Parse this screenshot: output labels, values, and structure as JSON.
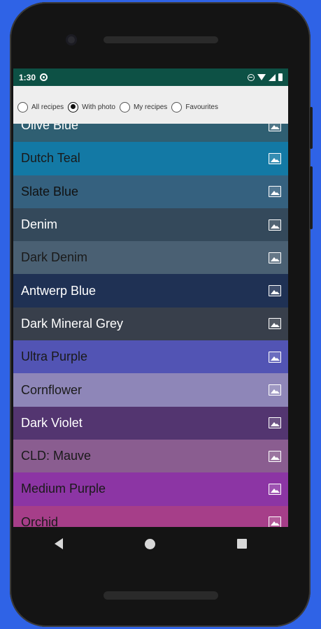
{
  "status_bar": {
    "time": "1:30"
  },
  "filters": [
    {
      "label": "All recipes",
      "checked": false
    },
    {
      "label": "With photo",
      "checked": true
    },
    {
      "label": "My recipes",
      "checked": false
    },
    {
      "label": "Favourites",
      "checked": false
    }
  ],
  "colors": [
    {
      "name": "Olive Blue",
      "bg": "#2f5f72",
      "fg": "#ffffff"
    },
    {
      "name": "Dutch Teal",
      "bg": "#1379a5",
      "fg": "#1a1a1a"
    },
    {
      "name": "Slate Blue",
      "bg": "#35617f",
      "fg": "#111111"
    },
    {
      "name": "Denim",
      "bg": "#34495b",
      "fg": "#ffffff"
    },
    {
      "name": "Dark Denim",
      "bg": "#4a6073",
      "fg": "#1a1a1a"
    },
    {
      "name": "Antwerp Blue",
      "bg": "#1f3154",
      "fg": "#ffffff"
    },
    {
      "name": "Dark Mineral Grey",
      "bg": "#383f4b",
      "fg": "#ffffff"
    },
    {
      "name": "Ultra Purple",
      "bg": "#5254b4",
      "fg": "#1a1a1a"
    },
    {
      "name": "Cornflower",
      "bg": "#8e86b8",
      "fg": "#1a1a1a"
    },
    {
      "name": "Dark Violet",
      "bg": "#533570",
      "fg": "#ffffff"
    },
    {
      "name": "CLD: Mauve",
      "bg": "#8a5d90",
      "fg": "#1a1a1a"
    },
    {
      "name": "Medium Purple",
      "bg": "#8c35a4",
      "fg": "#1a1a1a"
    },
    {
      "name": "Orchid",
      "bg": "#a63e89",
      "fg": "#1a1a1a"
    }
  ]
}
